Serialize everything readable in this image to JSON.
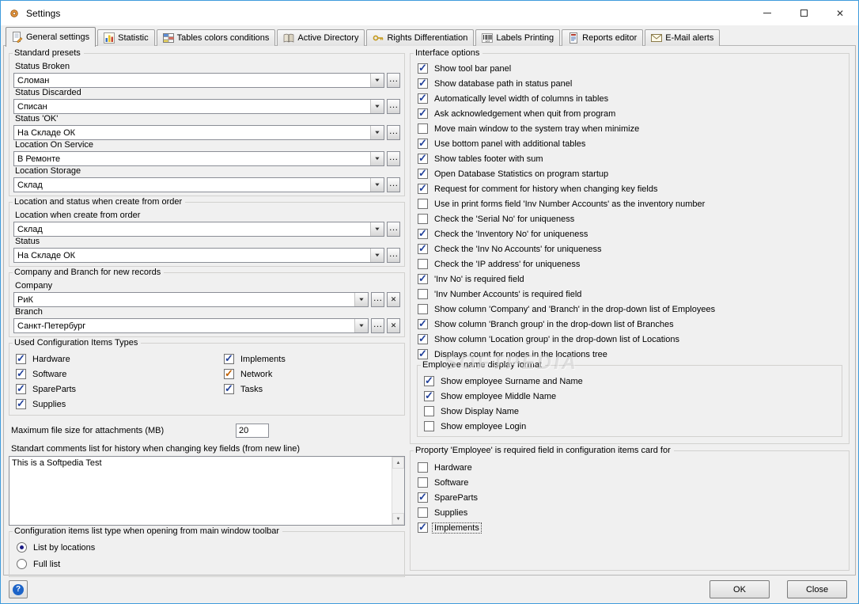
{
  "window": {
    "title": "Settings"
  },
  "icons": {
    "dropdown": "▼",
    "ellipsis": "…",
    "clear": "✕",
    "help": "?",
    "arrow_up": "▲",
    "arrow_down": "▼"
  },
  "tabs": [
    {
      "label": "General settings"
    },
    {
      "label": "Statistic"
    },
    {
      "label": "Tables colors conditions"
    },
    {
      "label": "Active Directory"
    },
    {
      "label": "Rights Differentiation"
    },
    {
      "label": "Labels Printing"
    },
    {
      "label": "Reports editor"
    },
    {
      "label": "E-Mail alerts"
    }
  ],
  "left": {
    "standard_presets": {
      "title": "Standard presets",
      "fields": [
        {
          "label": "Status Broken",
          "value": "Сломан"
        },
        {
          "label": "Status Discarded",
          "value": "Списан"
        },
        {
          "label": "Status 'OK'",
          "value": "На Складе ОК"
        },
        {
          "label": "Location On Service",
          "value": "В Ремонте"
        },
        {
          "label": "Location Storage",
          "value": "Склад"
        }
      ]
    },
    "order_defaults": {
      "title": "Location and status when create from order",
      "fields": [
        {
          "label": "Location when create from order",
          "value": "Склад"
        },
        {
          "label": "Status",
          "value": "На Складе ОК"
        }
      ]
    },
    "company_branch": {
      "title": "Company and Branch for new records",
      "fields": [
        {
          "label": "Company",
          "value": "РиК"
        },
        {
          "label": "Branch",
          "value": "Санкт-Петербург"
        }
      ]
    },
    "used_types": {
      "title": "Used Configuration Items Types",
      "col1": [
        {
          "label": "Hardware",
          "checked": true
        },
        {
          "label": "Software",
          "checked": true
        },
        {
          "label": "SpareParts",
          "checked": true
        },
        {
          "label": "Supplies",
          "checked": true
        }
      ],
      "col2": [
        {
          "label": "Implements",
          "checked": true
        },
        {
          "label": "Network",
          "checked": true,
          "check_color": "#c06000"
        },
        {
          "label": "Tasks",
          "checked": true
        }
      ]
    },
    "max_file_size": {
      "label": "Maximum file size for attachments (MB)",
      "value": "20"
    },
    "comments": {
      "label": "Standart comments list for history when changing key fields (from new line)",
      "value": "This is a Softpedia Test"
    },
    "list_type": {
      "title": "Configuration items list type when opening from main window toolbar",
      "options": [
        {
          "label": "List by locations",
          "selected": true
        },
        {
          "label": "Full list"
        }
      ]
    }
  },
  "right": {
    "interface_options": {
      "title": "Interface options",
      "items": [
        {
          "label": "Show tool bar panel",
          "checked": true
        },
        {
          "label": "Show database path in status panel",
          "checked": true
        },
        {
          "label": "Automatically level width of columns in tables",
          "checked": true
        },
        {
          "label": "Ask acknowledgement when quit from program",
          "checked": true
        },
        {
          "label": "Move main window to the system tray when minimize"
        },
        {
          "label": "Use bottom panel with additional tables",
          "checked": true
        },
        {
          "label": "Show tables footer with sum",
          "checked": true
        },
        {
          "label": "Open Database Statistics on program startup",
          "checked": true
        },
        {
          "label": "Request for comment for history when changing key fields",
          "checked": true
        },
        {
          "label": "Use in print forms field 'Inv Number Accounts' as the inventory number"
        },
        {
          "label": "Check the 'Serial No' for uniqueness"
        },
        {
          "label": "Check the 'Inventory No' for uniqueness",
          "checked": true
        },
        {
          "label": "Check the 'Inv No Accounts' for uniqueness",
          "checked": true
        },
        {
          "label": "Check the 'IP address' for uniqueness"
        },
        {
          "label": "'Inv No' is required field",
          "checked": true
        },
        {
          "label": "'Inv Number Accounts' is required field"
        },
        {
          "label": "Show column 'Company' and 'Branch' in the drop-down list of Employees"
        },
        {
          "label": "Show column 'Branch group' in the drop-down list of Branches",
          "checked": true
        },
        {
          "label": "Show column 'Location group' in the drop-down list of Locations",
          "checked": true
        },
        {
          "label": "Displays count for nodes in the locations tree",
          "checked": true
        }
      ]
    },
    "employee_format": {
      "title": "Employee name display format",
      "items": [
        {
          "label": "Show employee Surname and Name",
          "checked": true
        },
        {
          "label": "Show employee Middle Name",
          "checked": true
        },
        {
          "label": "Show Display Name"
        },
        {
          "label": "Show employee Login"
        }
      ]
    },
    "employee_required": {
      "title": "Proporty 'Employee' is required field in configuration items card for",
      "items": [
        {
          "label": "Hardware"
        },
        {
          "label": "Software"
        },
        {
          "label": "SpareParts",
          "checked": true
        },
        {
          "label": "Supplies"
        },
        {
          "label": "Implements",
          "checked": true,
          "focused": true
        }
      ]
    }
  },
  "footer": {
    "ok": "OK",
    "close": "Close"
  },
  "watermark": "SOFTPEDIA",
  "colors": {
    "window_border": "#3f9bdc",
    "background": "#f0f0f0",
    "titlebar_bg": "#ffffff",
    "check": "#21409a",
    "check_network": "#c06000"
  }
}
